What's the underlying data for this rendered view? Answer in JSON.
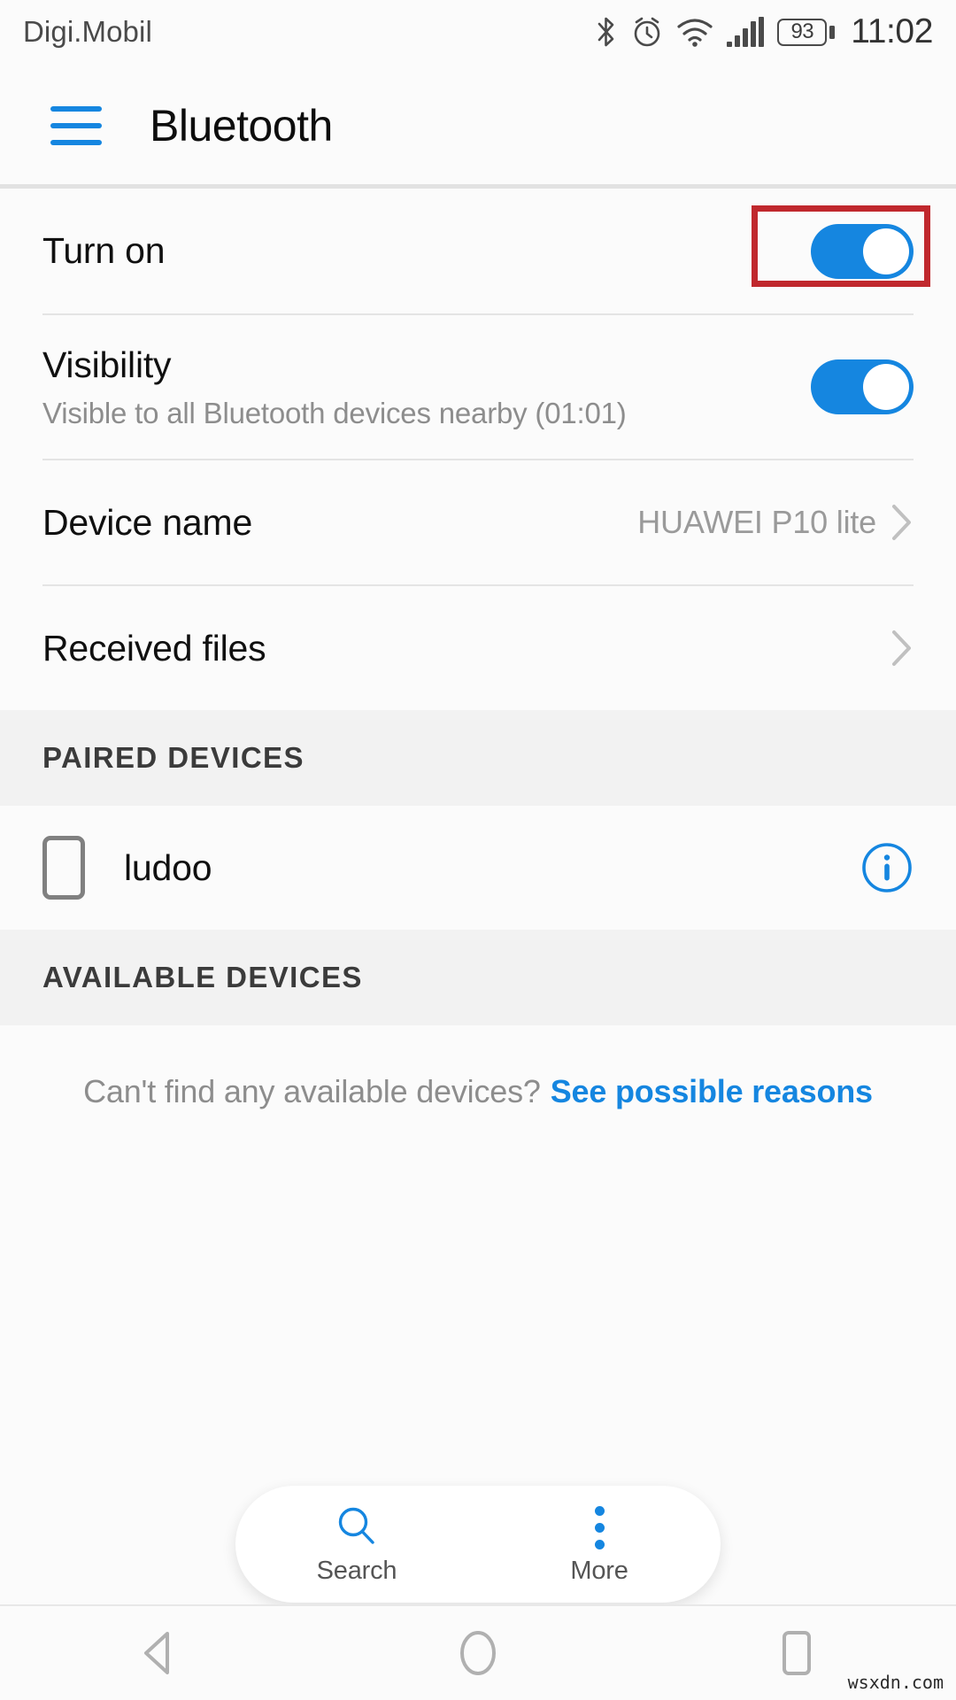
{
  "statusbar": {
    "carrier": "Digi.Mobil",
    "battery_percent": "93",
    "time": "11:02",
    "icons": [
      "bluetooth-icon",
      "alarm-icon",
      "wifi-icon",
      "signal-icon",
      "battery-icon"
    ]
  },
  "appbar": {
    "menu_icon": "hamburger-menu-icon",
    "title": "Bluetooth"
  },
  "settings": {
    "turn_on": {
      "label": "Turn on",
      "toggle_state": "on",
      "highlighted": true
    },
    "visibility": {
      "label": "Visibility",
      "sublabel": "Visible to all Bluetooth devices nearby (01:01)",
      "toggle_state": "on"
    },
    "device_name": {
      "label": "Device name",
      "value": "HUAWEI P10 lite"
    },
    "received_files": {
      "label": "Received files"
    }
  },
  "paired_section": {
    "header": "PAIRED DEVICES",
    "devices": [
      {
        "name": "ludoo",
        "icon": "phone-icon",
        "info_icon": "info-circle-icon"
      }
    ]
  },
  "available_section": {
    "header": "AVAILABLE DEVICES",
    "empty_text": "Can't find any available devices?",
    "empty_link": "See possible reasons"
  },
  "toolbar": {
    "items": [
      {
        "label": "Search",
        "icon": "search-icon"
      },
      {
        "label": "More",
        "icon": "more-vertical-icon"
      }
    ]
  },
  "navbar": {
    "back": "back-button",
    "home": "home-button",
    "recents": "recents-button"
  },
  "watermark": "wsxdn.com",
  "colors": {
    "accent": "#1586e0",
    "highlight": "#c0282d",
    "background": "#fbfbfb",
    "section_bg": "#f2f2f2",
    "muted_text": "#8d8d8d"
  }
}
